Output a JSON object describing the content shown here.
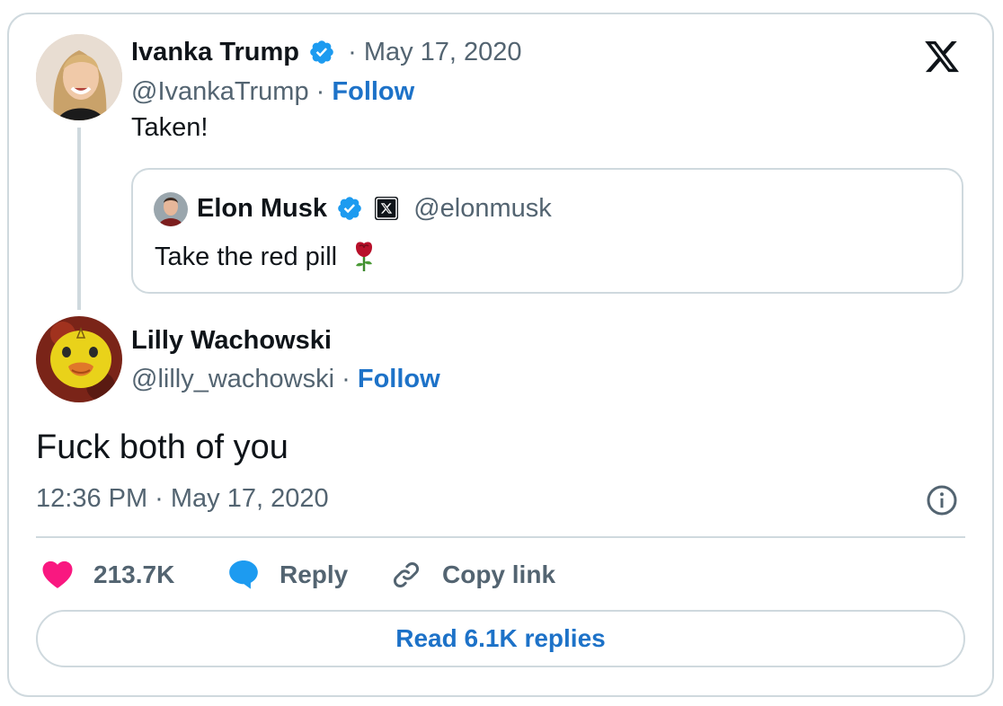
{
  "parent_tweet": {
    "name": "Ivanka Trump",
    "sep": "·",
    "date": "May 17, 2020",
    "handle": "@IvankaTrump",
    "handle_sep": "·",
    "follow": "Follow",
    "text": "Taken!",
    "verified_icon": "verified-badge-icon",
    "quoted": {
      "name": "Elon Musk",
      "handle": "@elonmusk",
      "text": "Take the red pill",
      "emoji_icon": "rose-emoji-icon",
      "affiliate_icon": "x-affiliate-icon"
    }
  },
  "main_tweet": {
    "name": "Lilly Wachowski",
    "handle": "@lilly_wachowski",
    "handle_sep": "·",
    "follow": "Follow",
    "text": "Fuck both of you",
    "timestamp": "12:36 PM · May 17, 2020"
  },
  "actions": {
    "likes": "213.7K",
    "reply": "Reply",
    "copy_link": "Copy link",
    "read_replies": "Read 6.1K replies"
  },
  "colors": {
    "accent": "#1d72c8",
    "verified": "#1d9bf0",
    "like": "#f91880",
    "muted": "#536471",
    "border": "#cfd9de"
  }
}
